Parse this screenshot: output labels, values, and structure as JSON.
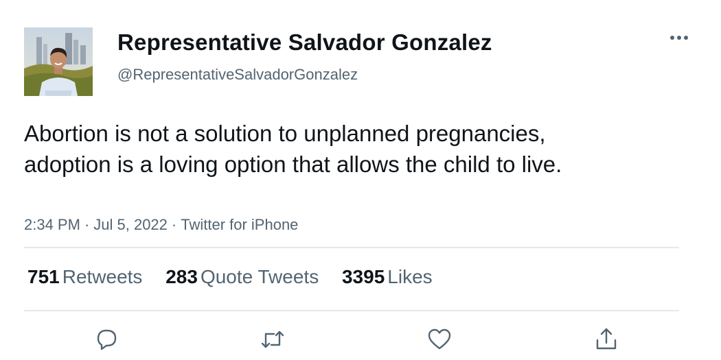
{
  "author": {
    "display_name": "Representative Salvador Gonzalez",
    "handle": "@RepresentativeSalvadorGonzalez",
    "avatar_icon": "profile-photo"
  },
  "tweet": {
    "text": "Abortion is not a solution to unplanned pregnancies, adoption is a loving option that allows the child to live.",
    "time": "2:34 PM",
    "date": "Jul 5, 2022",
    "source": "Twitter for iPhone",
    "separator": "·"
  },
  "stats": {
    "retweets": {
      "count": "751",
      "label": "Retweets"
    },
    "quote_tweets": {
      "count": "283",
      "label": "Quote Tweets"
    },
    "likes": {
      "count": "3395",
      "label": "Likes"
    }
  },
  "actions": [
    {
      "name": "reply",
      "icon": "speech-bubble-icon"
    },
    {
      "name": "retweet",
      "icon": "retweet-arrows-icon"
    },
    {
      "name": "like",
      "icon": "heart-icon"
    },
    {
      "name": "share",
      "icon": "share-upload-icon"
    }
  ],
  "colors": {
    "text_primary": "#0f1419",
    "text_secondary": "#536471",
    "divider": "#e4e8eb",
    "icon": "#536471"
  }
}
